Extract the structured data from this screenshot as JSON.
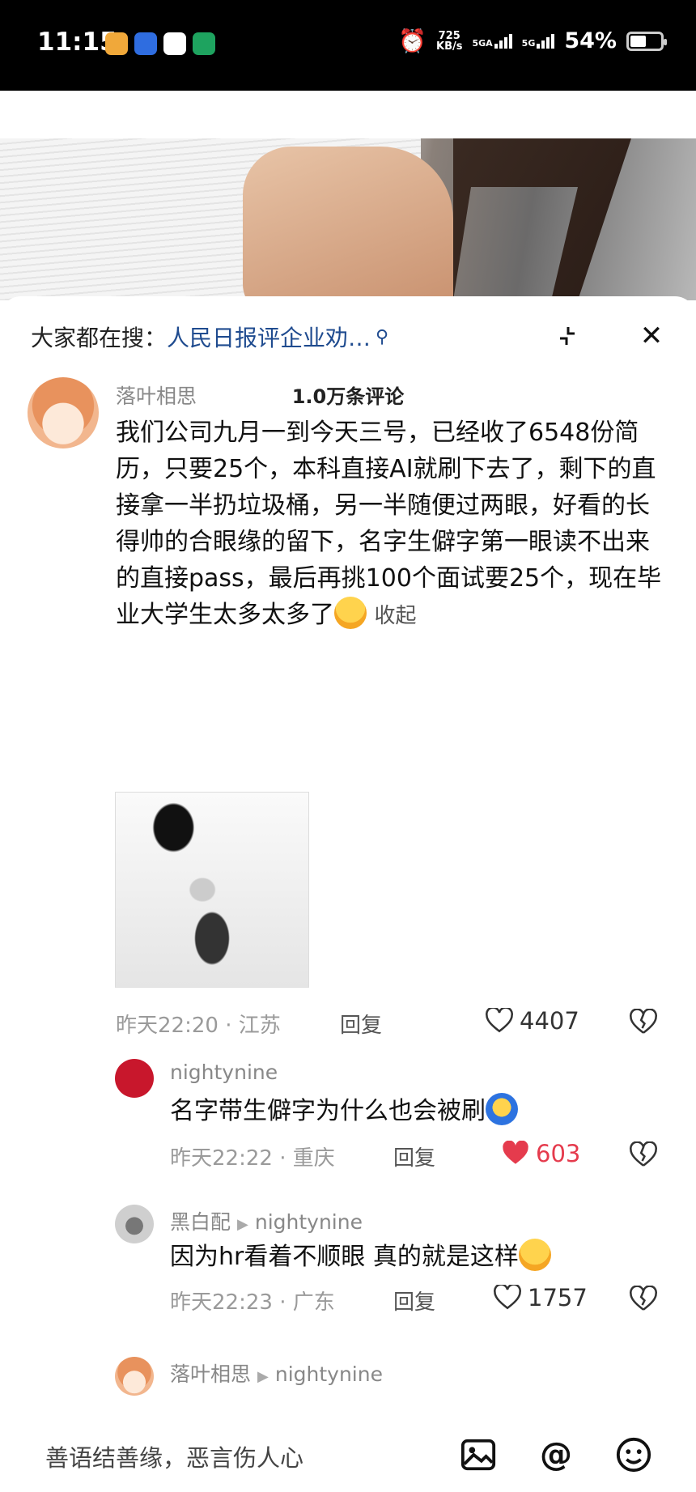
{
  "status_bar": {
    "time": "11:15",
    "net_speed_value": "725",
    "net_speed_unit": "KB/s",
    "signal1_label": "5GA",
    "signal2_label": "5G",
    "battery_text": "54%",
    "battery_level": 0.54
  },
  "header": {
    "search_prefix": "大家都在搜：",
    "search_term": "人民日报评企业劝…",
    "comment_count": "1.0万条评论"
  },
  "comments": [
    {
      "author": "落叶相思",
      "text": "我们公司九月一到今天三号，已经收了6548份简历，只要25个，本科直接AI就刷下去了，剩下的直接拿一半扔垃圾桶，另一半随便过两眼，好看的长得帅的合眼缘的留下，名字生僻字第一眼读不出来的直接pass，最后再挑100个面试要25个，现在毕业大学生太多太多了",
      "collapse_label": "收起",
      "time": "昨天22:20",
      "location": "江苏",
      "reply_label": "回复",
      "likes": "4407"
    },
    {
      "author": "nightynine",
      "text": "名字带生僻字为什么也会被刷",
      "time": "昨天22:22",
      "location": "重庆",
      "reply_label": "回复",
      "likes": "603"
    },
    {
      "author": "黑白配",
      "reply_to": "nightynine",
      "text": "因为hr看着不顺眼 真的就是这样",
      "time": "昨天22:23",
      "location": "广东",
      "reply_label": "回复",
      "likes": "1757"
    },
    {
      "author": "落叶相思",
      "reply_to": "nightynine"
    }
  ],
  "bottom_bar": {
    "placeholder": "善语结善缘，恶言伤人心"
  },
  "colors": {
    "link_blue": "#1f4b8f",
    "like_red": "#e53b4d",
    "muted_gray": "#9a9a9a"
  },
  "icons": [
    "compress-icon",
    "close-icon",
    "search-icon",
    "heart-icon",
    "heart-filled-icon",
    "broken-heart-icon",
    "image-icon",
    "at-icon",
    "emoji-icon"
  ]
}
